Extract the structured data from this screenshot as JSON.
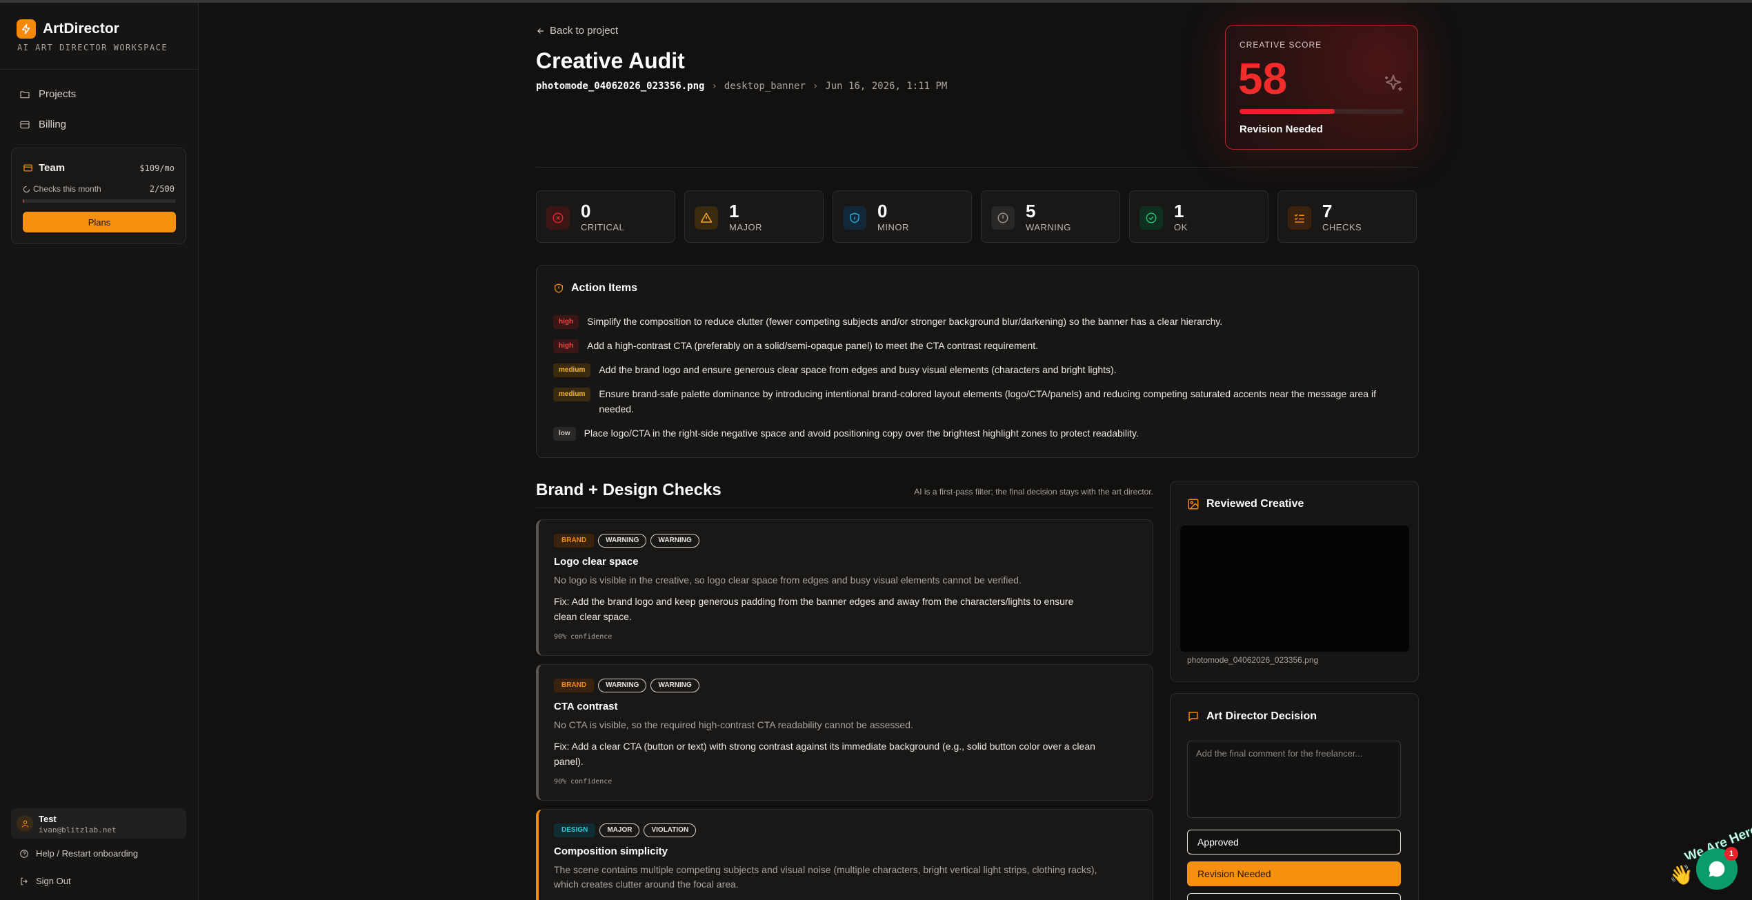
{
  "app": {
    "name": "ArtDirector",
    "subtitle": "AI ART DIRECTOR WORKSPACE",
    "accent": "#f58a0a"
  },
  "sidebar": {
    "nav": [
      {
        "label": "Projects",
        "icon": "folder-icon"
      },
      {
        "label": "Billing",
        "icon": "credit-card-icon"
      }
    ],
    "plan": {
      "name": "Team",
      "price": "$109/mo",
      "usage_label": "Checks this month",
      "usage_count": "2/500",
      "usage_fraction": 0.004,
      "button": "Plans"
    },
    "user": {
      "name": "Test",
      "email": "ivan@blitzlab.net"
    },
    "footer": [
      {
        "label": "Help / Restart onboarding",
        "icon": "help-icon"
      },
      {
        "label": "Sign Out",
        "icon": "sign-out-icon"
      }
    ]
  },
  "header": {
    "back_label": "Back to project",
    "title": "Creative Audit",
    "file": "photomode_04062026_023356.png",
    "format": "desktop_banner",
    "date": "Jun 16, 2026, 1:11 PM"
  },
  "score": {
    "label": "CREATIVE SCORE",
    "value": "58",
    "fraction": 0.58,
    "status": "Revision Needed",
    "color": "#f22b2b"
  },
  "stats": [
    {
      "value": "0",
      "label": "CRITICAL",
      "icon": "x-circle-icon",
      "color": "#e8222a"
    },
    {
      "value": "1",
      "label": "MAJOR",
      "icon": "warning-triangle-icon",
      "color": "#f5a623"
    },
    {
      "value": "0",
      "label": "MINOR",
      "icon": "shield-info-icon",
      "color": "#2ea8d4"
    },
    {
      "value": "5",
      "label": "WARNING",
      "icon": "info-circle-icon",
      "color": "#8e8882"
    },
    {
      "value": "1",
      "label": "OK",
      "icon": "check-circle-icon",
      "color": "#1fbf75"
    },
    {
      "value": "7",
      "label": "CHECKS",
      "icon": "checklist-icon",
      "color": "#f58a0a"
    }
  ],
  "action_items": {
    "title": "Action Items",
    "items": [
      {
        "priority": "high",
        "text": "Simplify the composition to reduce clutter (fewer competing subjects and/or stronger background blur/darkening) so the banner has a clear hierarchy."
      },
      {
        "priority": "high",
        "text": "Add a high-contrast CTA (preferably on a solid/semi-opaque panel) to meet the CTA contrast requirement."
      },
      {
        "priority": "medium",
        "text": "Add the brand logo and ensure generous clear space from edges and busy visual elements (characters and bright lights)."
      },
      {
        "priority": "medium",
        "text": "Ensure brand-safe palette dominance by introducing intentional brand-colored layout elements (logo/CTA/panels) and reducing competing saturated accents near the message area if needed."
      },
      {
        "priority": "low",
        "text": "Place logo/CTA in the right-side negative space and avoid positioning copy over the brightest highlight zones to protect readability."
      }
    ]
  },
  "checks": {
    "title": "Brand + Design Checks",
    "note": "AI is a first-pass filter; the final decision stays with the art director.",
    "items": [
      {
        "category": "BRAND",
        "severity": "WARNING",
        "status": "WARNING",
        "title": "Logo clear space",
        "description": "No logo is visible in the creative, so logo clear space from edges and busy visual elements cannot be verified.",
        "fix": "Fix: Add the brand logo and keep generous padding from the banner edges and away from the characters/lights to ensure clean clear space.",
        "confidence": "90% confidence"
      },
      {
        "category": "BRAND",
        "severity": "WARNING",
        "status": "WARNING",
        "title": "CTA contrast",
        "description": "No CTA is visible, so the required high-contrast CTA readability cannot be assessed.",
        "fix": "Fix: Add a clear CTA (button or text) with strong contrast against its immediate background (e.g., solid button color over a clean panel).",
        "confidence": "90% confidence"
      },
      {
        "category": "DESIGN",
        "severity": "MAJOR",
        "status": "VIOLATION",
        "title": "Composition simplicity",
        "description": "The scene contains multiple competing subjects and visual noise (multiple characters, bright vertical light strips, clothing racks), which creates clutter around the focal area."
      }
    ]
  },
  "reviewed": {
    "title": "Reviewed Creative",
    "filename": "photomode_04062026_023356.png"
  },
  "decision": {
    "title": "Art Director Decision",
    "placeholder": "Add the final comment for the freelancer...",
    "approved": "Approved",
    "revision": "Revision Needed"
  },
  "chat": {
    "badge_text": "We Are Here!",
    "unread": "1"
  }
}
